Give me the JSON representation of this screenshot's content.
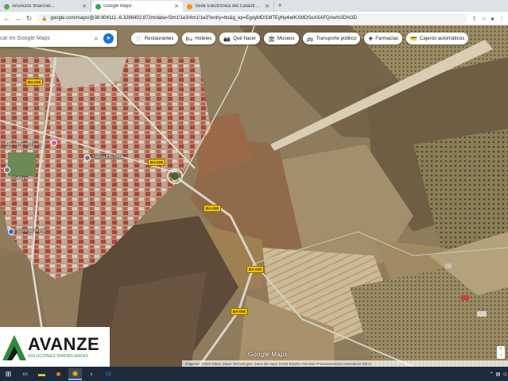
{
  "browser": {
    "tabs": [
      {
        "title": "Anuncios financier...",
        "favicon_color": "#4caf50",
        "active": false
      },
      {
        "title": "Google Maps",
        "favicon_color": "#34a853",
        "active": true
      },
      {
        "title": "Sede Electrónica del Catastro - ...",
        "favicon_color": "#f29900",
        "active": false
      }
    ],
    "url": "google.com/maps/@38.904111,-6.3286402,872m/data=!3m1!1e3!4m1!1e3?entry=ttu&g_ep=EgoyMDI1MTEyNy4wIKXMDSoASAFQAw%3D%3D",
    "new_tab_symbol": "+"
  },
  "maps": {
    "search_placeholder": "car en Google Maps",
    "chips": [
      {
        "icon": "fork-knife-icon",
        "glyph": "🍴",
        "label": "Restaurantes"
      },
      {
        "icon": "bed-icon",
        "glyph": "🛏",
        "label": "Hoteles"
      },
      {
        "icon": "camera-icon",
        "glyph": "📷",
        "label": "Qué hacer"
      },
      {
        "icon": "museum-icon",
        "glyph": "🏛",
        "label": "Museos"
      },
      {
        "icon": "bus-icon",
        "glyph": "🚌",
        "label": "Transporte público"
      },
      {
        "icon": "pharmacy-icon",
        "glyph": "✚",
        "label": "Farmacias"
      },
      {
        "icon": "atm-icon",
        "glyph": "💳",
        "label": "Cajeros automáticos"
      }
    ],
    "road_shields": [
      "BA-008",
      "BA-008",
      "BA-008",
      "BA-008",
      "BA-008"
    ],
    "place_labels": [
      "Apartamento Nayu",
      "Tiendas Bodega",
      "Colegio",
      "Bodega Monte"
    ],
    "google_logo": "Google Maps",
    "attribution": "Imágenes ©2025 Airbus, Maxar Technologies, Datos del mapa ©2025   España   Términos   Privacidad   Enviar comentarios   100 m"
  },
  "watermark": {
    "brand": "AVANZE",
    "subtitle": "SOLUCIONES INMOBILIARIAS"
  },
  "colors": {
    "accent": "#1a73e8",
    "brand_green": "#2e8b3a",
    "road_shield": "#f2c200"
  }
}
